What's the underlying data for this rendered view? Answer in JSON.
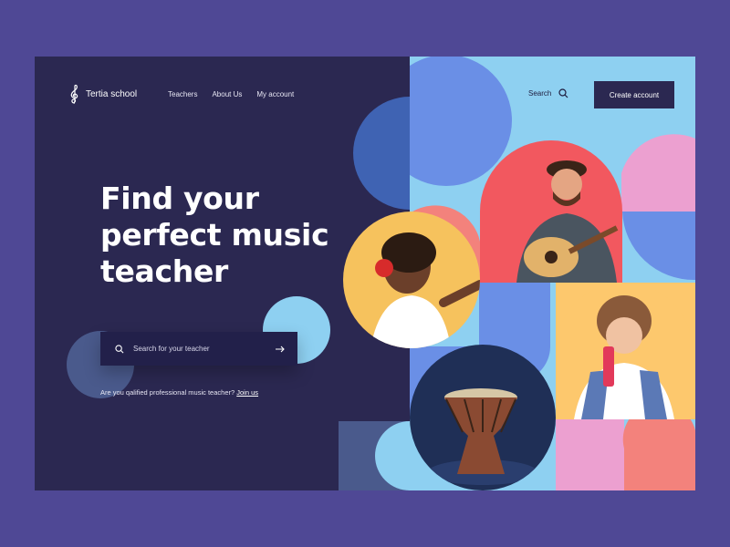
{
  "brand": {
    "name": "Tertia school",
    "logo_icon": "treble-clef-icon"
  },
  "nav": {
    "items": [
      {
        "label": "Teachers"
      },
      {
        "label": "About Us"
      },
      {
        "label": "My account"
      }
    ]
  },
  "header": {
    "search_label": "Search",
    "search_icon": "search-icon",
    "cta_label": "Create account"
  },
  "hero": {
    "title_line1": "Find your",
    "title_line2": "perfect music",
    "title_line3": "teacher"
  },
  "search": {
    "placeholder": "Search for your teacher",
    "submit_icon": "arrow-right-icon"
  },
  "join": {
    "text": "Are you qalified professional music teacher?",
    "link": "Join us"
  },
  "colors": {
    "page_bg": "#4f4895",
    "panel_dark": "#2b2851",
    "sky": "#8ed0f1",
    "blue": "#6a8fe6",
    "coral": "#f3827c",
    "red": "#f06063",
    "yellow": "#fdc86d",
    "pink": "#eca0d0"
  }
}
